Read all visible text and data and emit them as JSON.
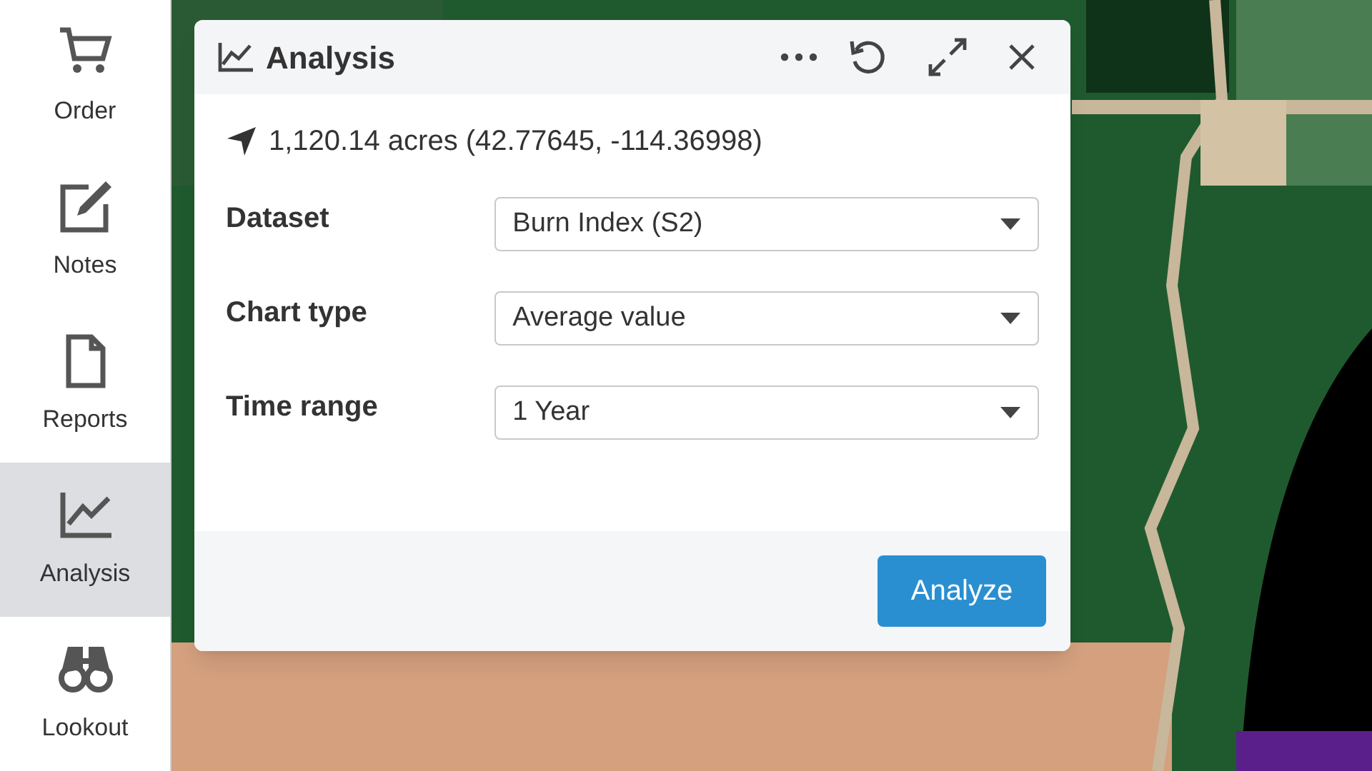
{
  "sidebar": {
    "items": [
      {
        "kind": "cart",
        "label": "Order",
        "selected": false
      },
      {
        "kind": "edit",
        "label": "Notes",
        "selected": false
      },
      {
        "kind": "file",
        "label": "Reports",
        "selected": false
      },
      {
        "kind": "chart",
        "label": "Analysis",
        "selected": true
      },
      {
        "kind": "binoculars",
        "label": "Lookout",
        "selected": false
      }
    ]
  },
  "panel": {
    "title": "Analysis",
    "location": "1,120.14 acres (42.77645, -114.36998)",
    "fields": [
      {
        "label": "Dataset",
        "value": "Burn Index (S2)"
      },
      {
        "label": "Chart type",
        "value": "Average value"
      },
      {
        "label": "Time range",
        "value": "1 Year"
      }
    ],
    "button": "Analyze"
  }
}
